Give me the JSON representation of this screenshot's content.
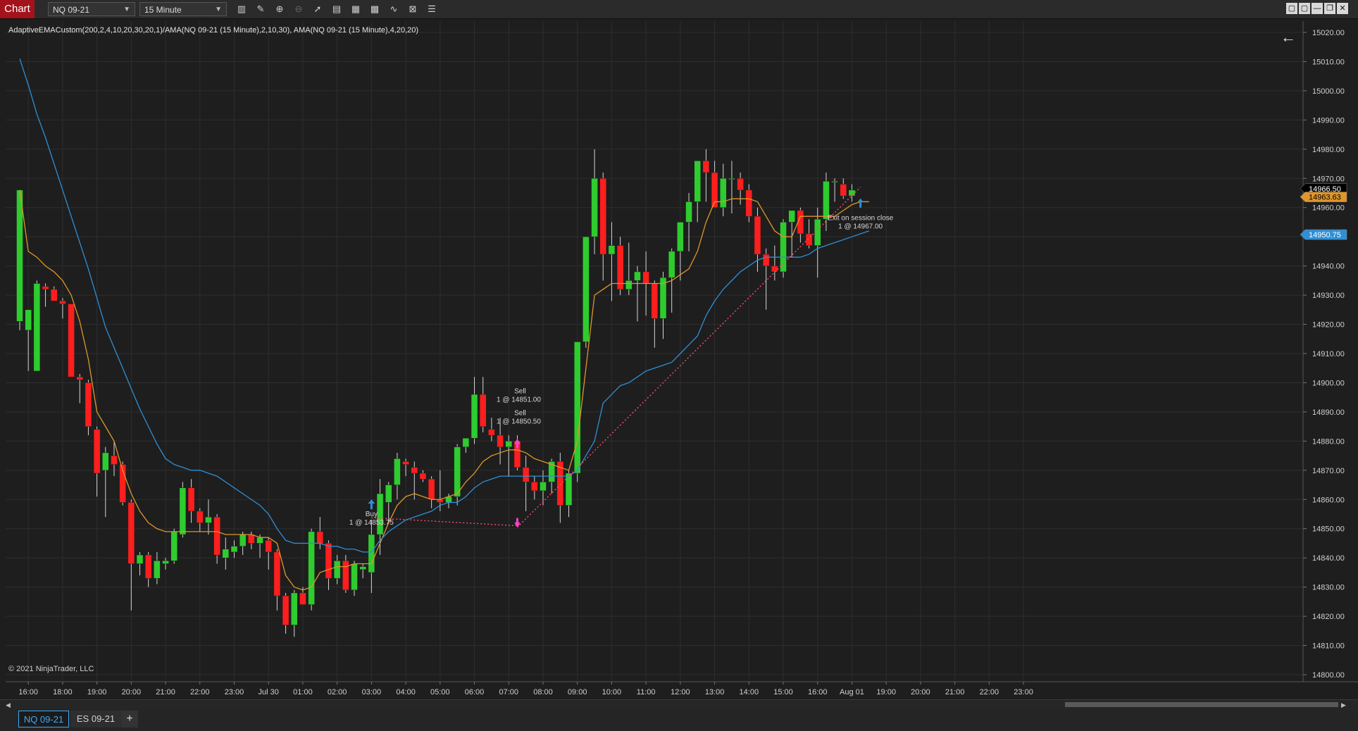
{
  "toolbar": {
    "chart_label": "Chart",
    "instrument": "NQ 09-21",
    "interval": "15 Minute",
    "window_buttons": [
      "▢",
      "▢",
      "—",
      "❐",
      "✕"
    ]
  },
  "indicator_label": "AdaptiveEMACustom(200,2,4,10,20,30,20,1)/AMA(NQ 09-21 (15 Minute),2,10,30), AMA(NQ 09-21 (15 Minute),4,20,20)",
  "copyright": "© 2021 NinjaTrader, LLC",
  "tabs": [
    "NQ 09-21",
    "ES 09-21"
  ],
  "tab_add": "+",
  "colors": {
    "background": "#1e1e1e",
    "grid": "#2e2e2e",
    "up_candle": "#2ecc2e",
    "down_candle": "#ff1e1e",
    "ama_fast": "#e0962a",
    "ama_slow": "#2f8fd6",
    "trade_line": "#ff4d6d",
    "buy_marker": "#2f8fd6",
    "sell_marker": "#ff3fcf"
  },
  "chart_data": {
    "type": "candlestick",
    "ylim": [
      14800,
      15020
    ],
    "y_ticks": [
      "15020.00",
      "15010.00",
      "15000.00",
      "14990.00",
      "14980.00",
      "14970.00",
      "14960.00",
      "14950.00",
      "14940.00",
      "14930.00",
      "14920.00",
      "14910.00",
      "14900.00",
      "14890.00",
      "14880.00",
      "14870.00",
      "14860.00",
      "14850.00",
      "14840.00",
      "14830.00",
      "14820.00",
      "14810.00",
      "14800.00"
    ],
    "x_ticks": [
      "16:00",
      "18:00",
      "19:00",
      "20:00",
      "21:00",
      "22:00",
      "23:00",
      "Jul 30",
      "01:00",
      "02:00",
      "03:00",
      "04:00",
      "05:00",
      "06:00",
      "07:00",
      "08:00",
      "09:00",
      "10:00",
      "11:00",
      "12:00",
      "13:00",
      "14:00",
      "15:00",
      "16:00",
      "Aug 01",
      "19:00",
      "20:00",
      "21:00",
      "22:00",
      "23:00"
    ],
    "x_tick_bar_index": [
      1,
      5,
      9,
      13,
      17,
      21,
      25,
      29,
      33,
      37,
      41,
      45,
      49,
      53,
      57,
      61,
      65,
      69,
      73,
      77,
      81,
      85,
      89,
      93,
      97,
      101,
      105,
      109,
      113,
      117
    ],
    "ohlc": [
      [
        14921,
        14966,
        14918,
        14966
      ],
      [
        14918,
        14925,
        14904,
        14925
      ],
      [
        14904,
        14935,
        14904,
        14934
      ],
      [
        14933,
        14934,
        14926,
        14932
      ],
      [
        14932,
        14933,
        14928,
        14928
      ],
      [
        14928,
        14929,
        14922,
        14927
      ],
      [
        14927,
        14924,
        14902,
        14902
      ],
      [
        14902,
        14903,
        14893,
        14901
      ],
      [
        14900,
        14901,
        14882,
        14885
      ],
      [
        14884,
        14885,
        14861,
        14869
      ],
      [
        14870,
        14878,
        14854,
        14876
      ],
      [
        14875,
        14880,
        14868,
        14872
      ],
      [
        14872,
        14873,
        14858,
        14859
      ],
      [
        14859,
        14860,
        14822,
        14838
      ],
      [
        14838,
        14842,
        14834,
        14841
      ],
      [
        14841,
        14842,
        14830,
        14833
      ],
      [
        14833,
        14842,
        14831,
        14839
      ],
      [
        14838,
        14840,
        14836,
        14839
      ],
      [
        14839,
        14850,
        14838,
        14849
      ],
      [
        14848,
        14866,
        14847,
        14864
      ],
      [
        14864,
        14867,
        14852,
        14856
      ],
      [
        14856,
        14857,
        14849,
        14852
      ],
      [
        14852,
        14860,
        14848,
        14854
      ],
      [
        14854,
        14855,
        14838,
        14841
      ],
      [
        14840,
        14847,
        14836,
        14843
      ],
      [
        14842,
        14846,
        14840,
        14844
      ],
      [
        14844,
        14849,
        14841,
        14848
      ],
      [
        14848,
        14849,
        14843,
        14845
      ],
      [
        14845,
        14848,
        14840,
        14847
      ],
      [
        14846,
        14847,
        14836,
        14842
      ],
      [
        14842,
        14843,
        14822,
        14827
      ],
      [
        14827,
        14828,
        14814,
        14817
      ],
      [
        14817,
        14829,
        14813,
        14828
      ],
      [
        14828,
        14830,
        14826,
        14824
      ],
      [
        14824,
        14850,
        14822,
        14849
      ],
      [
        14849,
        14854,
        14843,
        14845
      ],
      [
        14845,
        14846,
        14829,
        14833
      ],
      [
        14833,
        14841,
        14831,
        14839
      ],
      [
        14839,
        14841,
        14828,
        14829
      ],
      [
        14829,
        14839,
        14827,
        14838
      ],
      [
        14836,
        14838,
        14833,
        14837
      ],
      [
        14835,
        14853,
        14828,
        14848
      ],
      [
        14848,
        14867,
        14841,
        14862
      ],
      [
        14859,
        14866,
        14852,
        14865
      ],
      [
        14865,
        14876,
        14860,
        14874
      ],
      [
        14873,
        14874,
        14868,
        14872
      ],
      [
        14871,
        14873,
        14860,
        14869
      ],
      [
        14869,
        14870,
        14866,
        14867
      ],
      [
        14867,
        14868,
        14857,
        14860
      ],
      [
        14860,
        14870,
        14856,
        14859
      ],
      [
        14859,
        14862,
        14857,
        14861
      ],
      [
        14861,
        14879,
        14858,
        14878
      ],
      [
        14878,
        14880,
        14876,
        14881
      ],
      [
        14881,
        14902,
        14879,
        14896
      ],
      [
        14896,
        14902,
        14883,
        14885
      ],
      [
        14884,
        14888,
        14880,
        14882
      ],
      [
        14882,
        14888,
        14872,
        14878
      ],
      [
        14878,
        14882,
        14868,
        14880
      ],
      [
        14880,
        14882,
        14870,
        14871
      ],
      [
        14871,
        14875,
        14856,
        14866
      ],
      [
        14866,
        14868,
        14860,
        14863
      ],
      [
        14863,
        14870,
        14858,
        14866
      ],
      [
        14866,
        14874,
        14862,
        14873
      ],
      [
        14873,
        14876,
        14852,
        14858
      ],
      [
        14858,
        14870,
        14854,
        14869
      ],
      [
        14869,
        14914,
        14866,
        14914
      ],
      [
        14914,
        14950,
        14912,
        14950
      ],
      [
        14950,
        14980,
        14944,
        14970
      ],
      [
        14970,
        14972,
        14935,
        14944
      ],
      [
        14944,
        14955,
        14928,
        14947
      ],
      [
        14947,
        14950,
        14930,
        14932
      ],
      [
        14932,
        14948,
        14930,
        14935
      ],
      [
        14935,
        14940,
        14921,
        14938
      ],
      [
        14938,
        14945,
        14923,
        14934
      ],
      [
        14934,
        14935,
        14912,
        14922
      ],
      [
        14922,
        14938,
        14915,
        14936
      ],
      [
        14936,
        14946,
        14924,
        14945
      ],
      [
        14945,
        14955,
        14935,
        14955
      ],
      [
        14955,
        14965,
        14945,
        14962
      ],
      [
        14962,
        14976,
        14955,
        14976
      ],
      [
        14976,
        14980,
        14962,
        14972
      ],
      [
        14972,
        14976,
        14960,
        14960
      ],
      [
        14960,
        14975,
        14957,
        14970
      ],
      [
        14970,
        14976,
        14958,
        14970
      ],
      [
        14970,
        14972,
        14961,
        14966
      ],
      [
        14966,
        14968,
        14955,
        14957
      ],
      [
        14957,
        14960,
        14938,
        14944
      ],
      [
        14944,
        14946,
        14925,
        14940
      ],
      [
        14940,
        14947,
        14935,
        14938
      ],
      [
        14938,
        14956,
        14936,
        14955
      ],
      [
        14955,
        14958,
        14943,
        14959
      ],
      [
        14959,
        14960,
        14948,
        14951
      ],
      [
        14951,
        14956,
        14946,
        14947
      ],
      [
        14947,
        14960,
        14936,
        14956
      ],
      [
        14956,
        14972,
        14952,
        14969
      ],
      [
        14969,
        14970,
        14962,
        14969
      ],
      [
        14968,
        14970,
        14963,
        14964
      ],
      [
        14964,
        14968,
        14962,
        14966
      ]
    ],
    "series": [
      {
        "name": "AMA(NQ 09-21 (15 Minute),2,10,30)",
        "color": "#e0962a",
        "values": [
          14966,
          14945,
          14943,
          14940,
          14938,
          14935,
          14930,
          14921,
          14908,
          14890,
          14885,
          14880,
          14870,
          14862,
          14856,
          14852,
          14850,
          14849,
          14849,
          14849,
          14849,
          14849,
          14849,
          14849,
          14848,
          14848,
          14848,
          14848,
          14847,
          14847,
          14845,
          14834,
          14830,
          14829,
          14830,
          14835,
          14836,
          14837,
          14837,
          14838,
          14838,
          14838,
          14845,
          14852,
          14858,
          14861,
          14862,
          14861,
          14860,
          14860,
          14861,
          14862,
          14866,
          14869,
          14873,
          14875,
          14876,
          14877,
          14877,
          14876,
          14874,
          14873,
          14872,
          14871,
          14870,
          14880,
          14905,
          14930,
          14932,
          14934,
          14934,
          14934,
          14934,
          14934,
          14934,
          14934,
          14935,
          14937,
          14939,
          14945,
          14955,
          14962,
          14962,
          14963,
          14963,
          14963,
          14962,
          14957,
          14952,
          14950,
          14950,
          14957,
          14957,
          14957,
          14957,
          14957,
          14959,
          14961,
          14962,
          14962
        ]
      },
      {
        "name": "AMA(NQ 09-21 (15 Minute),4,20,20)",
        "color": "#2f8fd6",
        "values": [
          15011,
          15002,
          14992,
          14984,
          14975,
          14966,
          14957,
          14948,
          14939,
          14929,
          14919,
          14912,
          14905,
          14898,
          14891,
          14885,
          14879,
          14874,
          14872,
          14871,
          14870,
          14870,
          14869,
          14868,
          14866,
          14864,
          14862,
          14860,
          14858,
          14855,
          14850,
          14846,
          14845,
          14845,
          14845,
          14845,
          14844,
          14844,
          14843,
          14843,
          14842,
          14842,
          14846,
          14849,
          14851,
          14853,
          14854,
          14855,
          14856,
          14858,
          14859,
          14859,
          14861,
          14864,
          14866,
          14867,
          14868,
          14868,
          14868,
          14868,
          14868,
          14868,
          14868,
          14868,
          14868,
          14870,
          14875,
          14880,
          14893,
          14896,
          14899,
          14900,
          14902,
          14904,
          14905,
          14906,
          14907,
          14910,
          14913,
          14916,
          14923,
          14928,
          14932,
          14935,
          14938,
          14940,
          14942,
          14943,
          14943,
          14943,
          14943,
          14943,
          14944,
          14946,
          14947,
          14948,
          14949,
          14950,
          14951,
          14952
        ]
      }
    ],
    "price_labels": [
      {
        "value": 14966.5,
        "text": "14966.50",
        "bg": "#000000",
        "fg": "#ffffff"
      },
      {
        "value": 14963.63,
        "text": "14963.63",
        "bg": "#e0962a",
        "fg": "#000000"
      },
      {
        "value": 14950.75,
        "text": "14950.75",
        "bg": "#2f8fd6",
        "fg": "#ffffff"
      }
    ],
    "trades": [
      {
        "side": "Buy",
        "bar": 41,
        "price": 14853.75,
        "label": "Buy",
        "detail": "1 @ 14853.75"
      },
      {
        "side": "Sell",
        "bar": 58,
        "price": 14851.0,
        "label": "Sell",
        "detail": "1 @ 14851.00"
      },
      {
        "side": "Sell",
        "bar": 58,
        "price": 14850.5,
        "label": "Sell",
        "detail": "1 @ 14850.50"
      },
      {
        "side": "Exit",
        "bar": 98,
        "price": 14967.0,
        "label": "Exit on session close",
        "detail": "1 @ 14967.00"
      }
    ],
    "trade_lines": [
      {
        "from_bar": 41,
        "from_price": 14853.75,
        "to_bar": 58,
        "to_price": 14851.0
      },
      {
        "from_bar": 58,
        "from_price": 14850.5,
        "to_bar": 98,
        "to_price": 14967.0
      }
    ]
  }
}
